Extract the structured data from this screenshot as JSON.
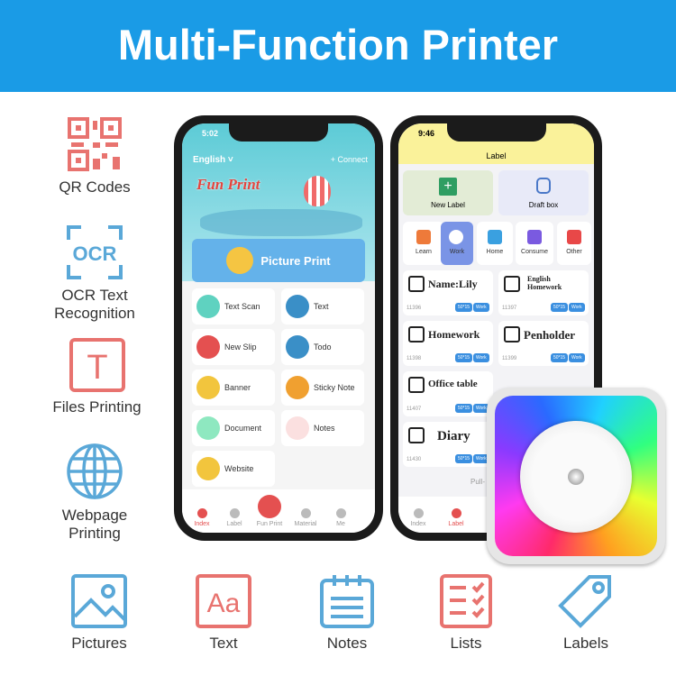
{
  "header": {
    "title": "Multi-Function Printer"
  },
  "colors": {
    "banner": "#1a9be6",
    "pink": "#e8736f",
    "blue": "#5aa8d8"
  },
  "features_left": [
    {
      "label": "QR Codes",
      "icon": "qr-code-icon"
    },
    {
      "label": "OCR Text Recognition",
      "icon": "ocr-icon",
      "icon_text": "OCR"
    },
    {
      "label": "Files Printing",
      "icon": "text-file-icon",
      "icon_text": "T"
    },
    {
      "label": "Webpage Printing",
      "icon": "globe-icon"
    }
  ],
  "features_bottom": [
    {
      "label": "Pictures",
      "icon": "picture-icon"
    },
    {
      "label": "Text",
      "icon": "text-icon",
      "icon_text": "Aa"
    },
    {
      "label": "Notes",
      "icon": "notes-icon"
    },
    {
      "label": "Lists",
      "icon": "list-icon"
    },
    {
      "label": "Labels",
      "icon": "tag-icon"
    }
  ],
  "phone1": {
    "time": "5:02",
    "language": "English",
    "connect": "+ Connect",
    "brand": "Fun Print",
    "picture_print": "Picture Print",
    "tiles": [
      "Text Scan",
      "Text",
      "New Slip",
      "Todo",
      "Banner",
      "Sticky Note",
      "Document",
      "Notes",
      "Website"
    ],
    "tabs": [
      "Index",
      "Label",
      "Fun Print",
      "Material",
      "Me"
    ]
  },
  "phone2": {
    "time": "9:46",
    "title": "Label",
    "new_label": "New Label",
    "draft_box": "Draft box",
    "categories": [
      "Learn",
      "Work",
      "Home",
      "Consume",
      "Other"
    ],
    "cards": [
      {
        "title": "Name:Lily",
        "num": "11396",
        "size": "50*15",
        "tag": "Work"
      },
      {
        "title": "English Homework",
        "num": "11397",
        "size": "50*15",
        "tag": "Work"
      },
      {
        "title": "Homework",
        "num": "11398",
        "size": "50*15",
        "tag": "Work"
      },
      {
        "title": "Penholder",
        "num": "11399",
        "size": "50*15",
        "tag": "Work"
      },
      {
        "title": "Office table",
        "num": "11407",
        "size": "50*15",
        "tag": "Work"
      },
      {
        "title": "Diary",
        "num": "11430",
        "size": "50*15",
        "tag": "Work"
      }
    ],
    "pull": "Pull-",
    "tabs": [
      "Index",
      "Label"
    ]
  }
}
